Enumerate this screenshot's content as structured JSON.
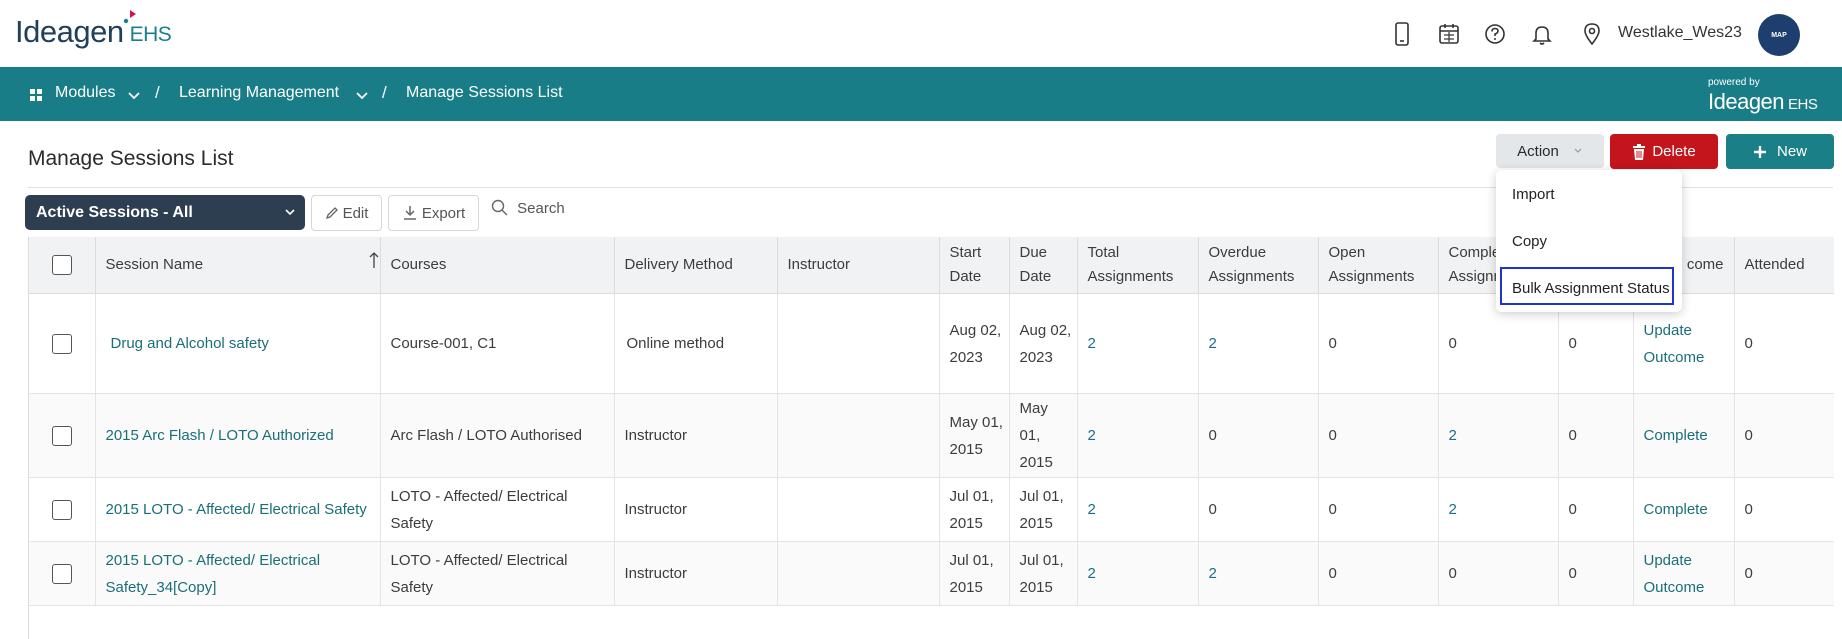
{
  "brand": {
    "logo_text": "Ideagen",
    "logo_suffix": "EHS"
  },
  "header": {
    "username": "Westlake_Wes23",
    "avatar_text": "MAP"
  },
  "breadcrumb": {
    "modules": "Modules",
    "sep1": "/",
    "learning": "Learning Management",
    "sep2": "/",
    "current": "Manage Sessions List"
  },
  "powered": {
    "label": "powered by",
    "brand": "Ideagen",
    "suffix": "EHS"
  },
  "page": {
    "title": "Manage Sessions List"
  },
  "actions": {
    "action": "Action",
    "delete": "Delete",
    "new": "New",
    "menu": [
      "Import",
      "Copy",
      "Bulk Assignment Status"
    ]
  },
  "toolbar": {
    "filter": "Active Sessions - All",
    "edit": "Edit",
    "export": "Export",
    "search": "Search"
  },
  "table": {
    "headers": {
      "session": "Session Name",
      "courses": "Courses",
      "delivery": "Delivery Method",
      "instructor": "Instructor",
      "start1": "Start",
      "start2": "Date",
      "due1": "Due",
      "due2": "Date",
      "total1": "Total",
      "total2": "Assignments",
      "overdue1": "Overdue",
      "overdue2": "Assignments",
      "open1": "Open",
      "open2": "Assignments",
      "completed1": "Comple",
      "completed2": "Assignm",
      "outcome": "come",
      "attended": "Attended"
    },
    "rows": [
      {
        "session": "Drug and Alcohol safety",
        "courses": "Course-001, C1",
        "delivery": "Online method",
        "instructor": "",
        "start": "Aug 02, 2023",
        "due": "Aug 02, 2023",
        "total": "2",
        "overdue": "2",
        "open": "0",
        "completed": "0",
        "extra": "0",
        "outcome": "Update Outcome",
        "attended": "0"
      },
      {
        "session": "2015 Arc Flash / LOTO Authorized",
        "courses": "Arc Flash / LOTO Authorised",
        "delivery": "Instructor",
        "instructor": "",
        "start": "May 01, 2015",
        "due": "May 01, 2015",
        "total": "2",
        "overdue": "0",
        "open": "0",
        "completed": "2",
        "extra": "0",
        "outcome": "Complete",
        "attended": "0"
      },
      {
        "session": "2015 LOTO - Affected/ Electrical Safety",
        "courses": "LOTO - Affected/ Electrical Safety",
        "delivery": "Instructor",
        "instructor": "",
        "start": "Jul 01, 2015",
        "due": "Jul 01, 2015",
        "total": "2",
        "overdue": "0",
        "open": "0",
        "completed": "2",
        "extra": "0",
        "outcome": "Complete",
        "attended": "0"
      },
      {
        "session": "2015 LOTO - Affected/ Electrical Safety_34[Copy]",
        "courses": "LOTO - Affected/ Electrical Safety",
        "delivery": "Instructor",
        "instructor": "",
        "start": "Jul 01, 2015",
        "due": "Jul 01, 2015",
        "total": "2",
        "overdue": "2",
        "open": "0",
        "completed": "0",
        "extra": "0",
        "outcome": "Update Outcome",
        "attended": "0"
      }
    ]
  }
}
